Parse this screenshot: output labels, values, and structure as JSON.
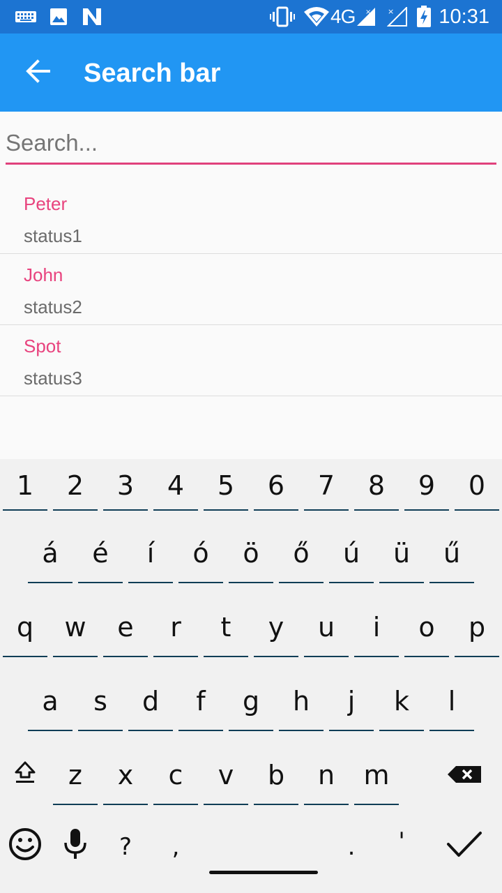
{
  "status_bar": {
    "time": "10:31",
    "network_label": "4G",
    "icons": [
      "keyboard-icon",
      "image-icon",
      "n-notification-icon",
      "vibrate-icon",
      "wifi-icon",
      "signal-icon",
      "signal-no-service-icon",
      "battery-charging-icon"
    ]
  },
  "app_bar": {
    "title": "Search bar",
    "back_icon": "arrow-back-icon",
    "color": "#2196f3"
  },
  "search": {
    "placeholder": "Search...",
    "value": "",
    "accent": "#e0417c"
  },
  "contacts": [
    {
      "name": "Peter",
      "status": "status1"
    },
    {
      "name": "John",
      "status": "status2"
    },
    {
      "name": "Spot",
      "status": "status3"
    }
  ],
  "keyboard": {
    "row_numbers": [
      "1",
      "2",
      "3",
      "4",
      "5",
      "6",
      "7",
      "8",
      "9",
      "0"
    ],
    "row_accents": [
      "á",
      "é",
      "í",
      "ó",
      "ö",
      "ő",
      "ú",
      "ü",
      "ű"
    ],
    "row_qwerty": [
      "q",
      "w",
      "e",
      "r",
      "t",
      "y",
      "u",
      "i",
      "o",
      "p"
    ],
    "row_home": [
      "a",
      "s",
      "d",
      "f",
      "g",
      "h",
      "j",
      "k",
      "l"
    ],
    "row_bottom": [
      "z",
      "x",
      "c",
      "v",
      "b",
      "n",
      "m"
    ],
    "row_space": {
      "question": "?",
      "comma": ",",
      "period": ".",
      "apostrophe": "'"
    },
    "icons": {
      "shift": "shift-icon",
      "backspace": "backspace-icon",
      "emoji": "emoji-icon",
      "mic": "microphone-icon",
      "done": "checkmark-icon"
    }
  }
}
